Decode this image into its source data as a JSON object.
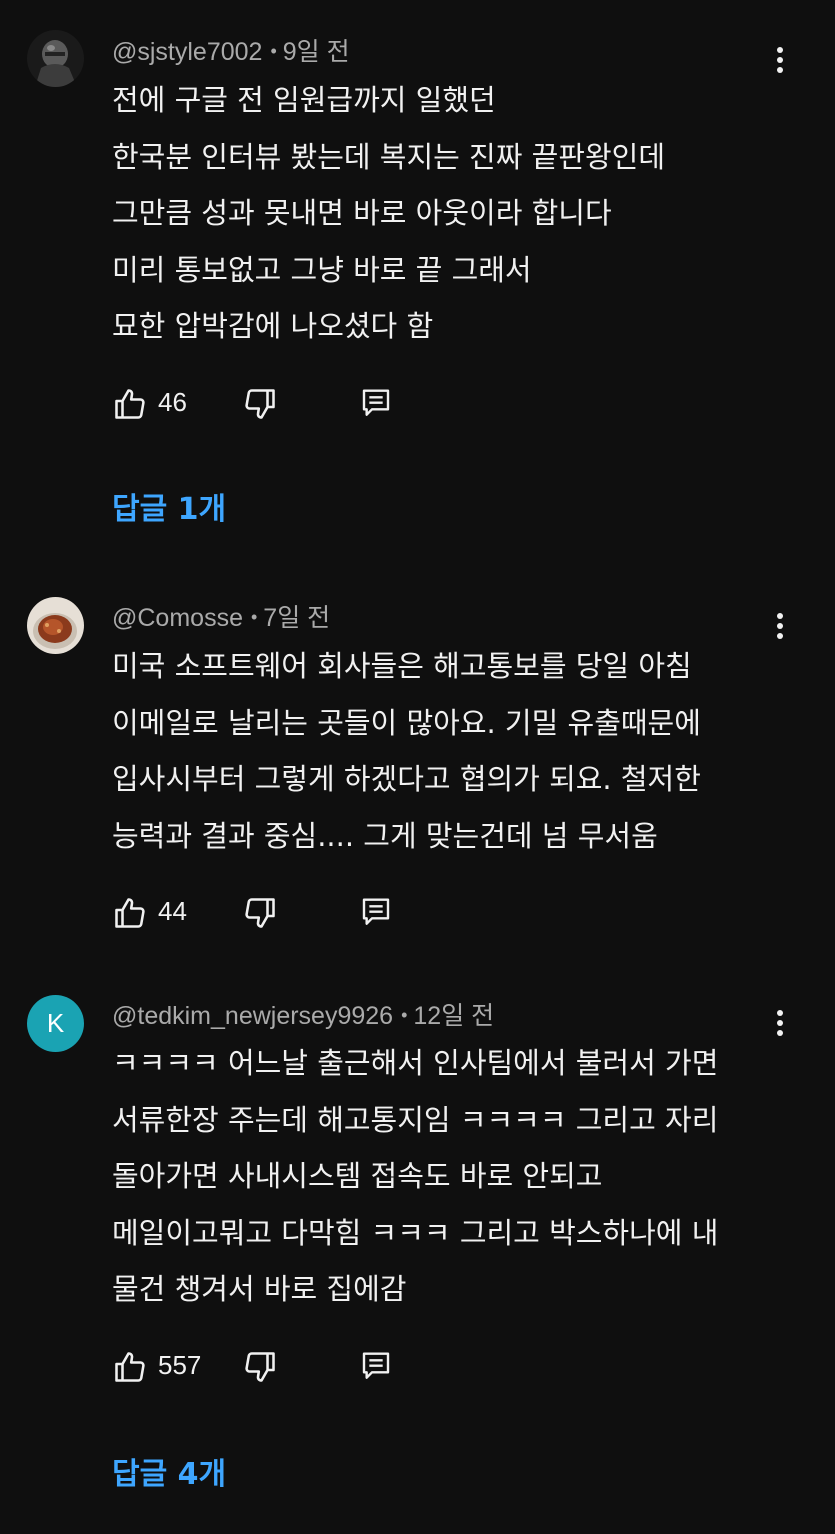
{
  "comments": [
    {
      "author": "@sjstyle7002",
      "time": "9일 전",
      "avatar": {
        "type": "image",
        "icon": "knight-helmet-avatar"
      },
      "lines": [
        "전에 구글 전 임원급까지 일했던",
        "한국분 인터뷰 봤는데 복지는 진짜 끝판왕인데",
        "그만큼 성과 못내면 바로 아웃이라 합니다",
        "미리 통보없고 그냥 바로 끝 그래서",
        "묘한 압박감에 나오셨다 함"
      ],
      "likes": "46",
      "replies_label": "답글 1개"
    },
    {
      "author": "@Comosse",
      "time": "7일 전",
      "avatar": {
        "type": "image",
        "icon": "coffee-cup-avatar"
      },
      "lines": [
        "미국 소프트웨어 회사들은 해고통보를 당일 아침",
        "이메일로 날리는 곳들이 많아요. 기밀 유출때문에",
        "입사시부터 그렇게 하겠다고 협의가 되요. 철저한",
        "능력과 결과 중심.... 그게 맞는건데 넘 무서움"
      ],
      "likes": "44",
      "replies_label": ""
    },
    {
      "author": "@tedkim_newjersey9926",
      "time": "12일 전",
      "avatar": {
        "type": "letter",
        "letter": "K",
        "color": "#1aa3b3"
      },
      "lines": [
        "ㅋㅋㅋㅋ 어느날 출근해서 인사팀에서 불러서 가면",
        "서류한장 주는데 해고통지임 ㅋㅋㅋㅋ 그리고 자리",
        "돌아가면 사내시스템 접속도 바로 안되고",
        "메일이고뭐고 다막힘 ㅋㅋㅋ 그리고 박스하나에 내",
        "물건 챙겨서 바로 집에감"
      ],
      "likes": "557",
      "replies_label": "답글 4개"
    }
  ],
  "icons": {
    "like": "thumb-up-icon",
    "dislike": "thumb-down-icon",
    "reply": "comment-reply-icon",
    "more": "more-vert-icon"
  },
  "colors": {
    "background": "#0f0f0f",
    "text": "#f1f1f1",
    "meta": "#aaaaaa",
    "link": "#3ea6ff"
  }
}
